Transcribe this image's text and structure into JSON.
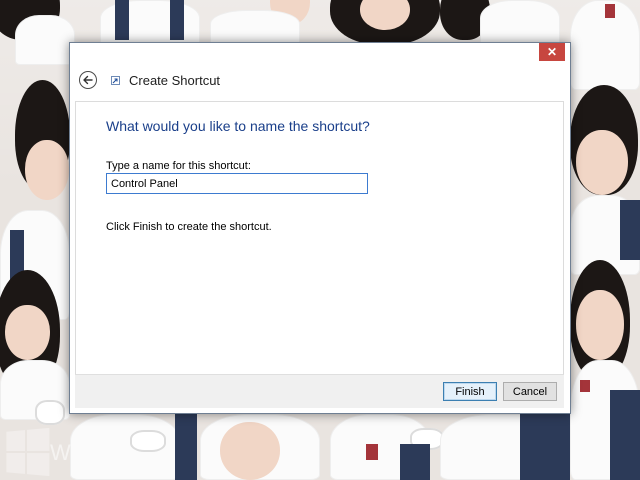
{
  "dialog": {
    "title": "Create Shortcut",
    "close_glyph": "✕",
    "back_glyph": "←",
    "heading": "What would you like to name the shortcut?",
    "field_label": "Type a name for this shortcut:",
    "name_value": "Control Panel",
    "hint": "Click Finish to create the shortcut.",
    "finish_label": "Finish",
    "cancel_label": "Cancel"
  },
  "icons": {
    "back": "back-arrow-icon",
    "wizard": "shortcut-wizard-icon",
    "close": "close-icon",
    "windows_logo": "windows-logo-icon"
  },
  "desktop": {
    "watermark_fragment": "W"
  },
  "colors": {
    "heading": "#1a3f8a",
    "close_button": "#c7463f",
    "input_border": "#3d7bd0",
    "footer": "#f0f0f0",
    "window_border": "#6f7f93"
  }
}
